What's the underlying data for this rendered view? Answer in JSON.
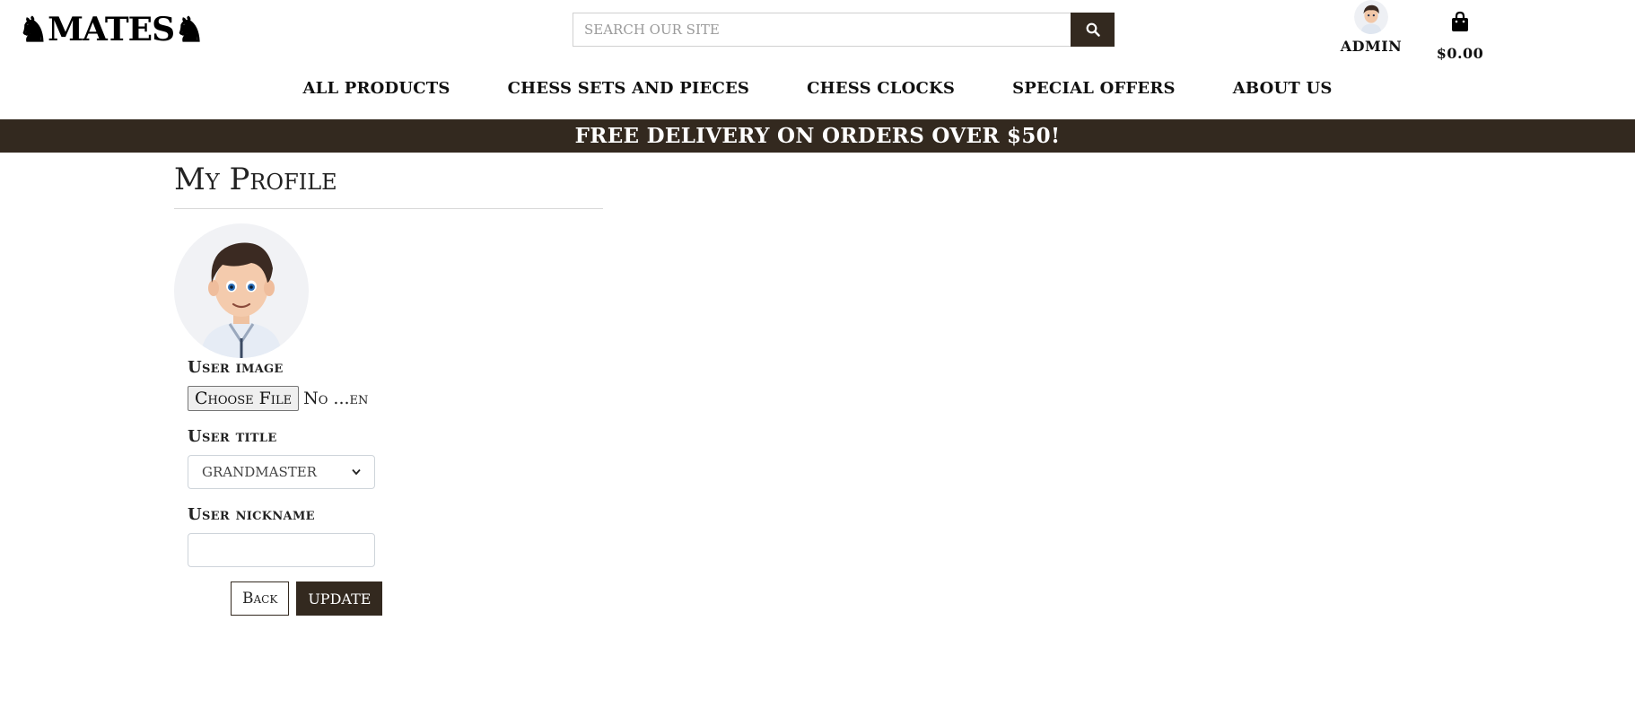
{
  "header": {
    "logo_text": "MATES",
    "search_placeholder": "SEARCH OUR SITE",
    "account_label": "ADMIN",
    "cart_total": "$0.00"
  },
  "nav": {
    "items": [
      {
        "label": "ALL PRODUCTS"
      },
      {
        "label": "CHESS SETS AND PIECES"
      },
      {
        "label": "CHESS CLOCKS"
      },
      {
        "label": "SPECIAL OFFERS"
      },
      {
        "label": "ABOUT US"
      }
    ]
  },
  "banner": {
    "text": "FREE DELIVERY ON ORDERS OVER $50!"
  },
  "profile": {
    "title": "My Profile",
    "user_image_label": "User image",
    "choose_file_label": "Choose File",
    "file_status": "No ...en",
    "user_title_label": "User title",
    "user_title_value": "GRANDMASTER",
    "user_nickname_label": "User nickname",
    "user_nickname_value": "",
    "back_label": "Back",
    "update_label": "UPDATE"
  },
  "colors": {
    "brand_dark": "#33291f",
    "text": "#1a1a1a"
  },
  "icons": {
    "logo": "chess-knight-icon",
    "search": "search-icon",
    "cart": "shopping-bag-icon",
    "avatar": "user-avatar"
  }
}
